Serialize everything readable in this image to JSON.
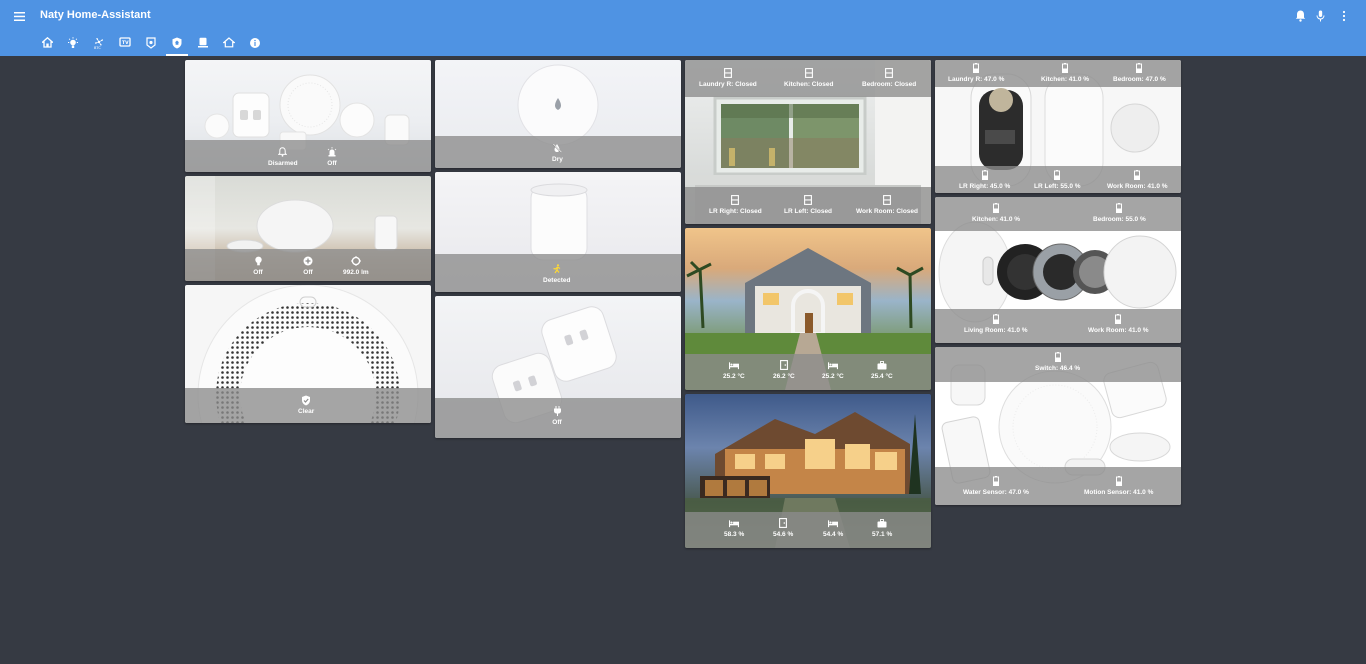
{
  "app": {
    "title": "Naty Home-Assistant"
  },
  "header": {
    "menu_icon": "menu-icon",
    "actions": [
      "bell-icon",
      "microphone-icon",
      "more-vert-icon"
    ]
  },
  "tabs": [
    {
      "icon": "home-icon"
    },
    {
      "icon": "lightbulb-on-icon"
    },
    {
      "icon": "fan-icon"
    },
    {
      "icon": "television-icon"
    },
    {
      "icon": "alarm-panel-icon"
    },
    {
      "icon": "shield-home-icon",
      "active": true
    },
    {
      "icon": "thermostat-icon"
    },
    {
      "icon": "house-roof-icon"
    },
    {
      "icon": "information-icon"
    }
  ],
  "cards": {
    "gateway": {
      "alarm": {
        "icon": "bell-outline-icon",
        "value": "Disarmed"
      },
      "siren": {
        "icon": "alarm-light-icon",
        "value": "Off"
      }
    },
    "gateway_light": {
      "light": {
        "icon": "lightbulb-icon",
        "value": "Off"
      },
      "switch": {
        "icon": "plus-circle-icon",
        "value": "Off"
      },
      "illuminance": {
        "icon": "brightness-icon",
        "value": "992.0 lm"
      }
    },
    "smoke": {
      "state": {
        "icon": "shield-check-icon",
        "value": "Clear"
      }
    },
    "water": {
      "state": {
        "icon": "water-off-icon",
        "value": "Dry"
      }
    },
    "motion": {
      "state": {
        "icon": "run-icon",
        "value": "Detected",
        "color": "#fdd835"
      }
    },
    "plug": {
      "state": {
        "icon": "power-plug-icon",
        "value": "Off"
      }
    },
    "windows": {
      "top": [
        {
          "icon": "window-closed-icon",
          "value": "Laundry R: Closed"
        },
        {
          "icon": "window-closed-icon",
          "value": "Kitchen: Closed"
        },
        {
          "icon": "window-closed-icon",
          "value": "Bedroom: Closed"
        }
      ],
      "bottom": [
        {
          "icon": "window-closed-icon",
          "value": "LR Right: Closed"
        },
        {
          "icon": "window-closed-icon",
          "value": "LR Left: Closed"
        },
        {
          "icon": "window-closed-icon",
          "value": "Work Room: Closed"
        }
      ]
    },
    "temperatures": [
      {
        "icon": "bed-icon",
        "value": "25.2 °C"
      },
      {
        "icon": "door-icon",
        "value": "26.2 °C"
      },
      {
        "icon": "bed-icon",
        "value": "25.2 °C"
      },
      {
        "icon": "briefcase-icon",
        "value": "25.4 °C"
      }
    ],
    "humidity": [
      {
        "icon": "bed-icon",
        "value": "58.3 %"
      },
      {
        "icon": "door-icon",
        "value": "54.6 %"
      },
      {
        "icon": "bed-icon",
        "value": "54.4 %"
      },
      {
        "icon": "briefcase-icon",
        "value": "57.1 %"
      }
    ],
    "battery_windows": {
      "top": [
        {
          "icon": "battery-icon",
          "value": "Laundry R: 47.0 %"
        },
        {
          "icon": "battery-icon",
          "value": "Kitchen: 41.0 %"
        },
        {
          "icon": "battery-icon",
          "value": "Bedroom: 47.0 %"
        }
      ],
      "bottom": [
        {
          "icon": "battery-icon",
          "value": "LR Right: 45.0 %"
        },
        {
          "icon": "battery-icon",
          "value": "LR Left: 55.0 %"
        },
        {
          "icon": "battery-icon",
          "value": "Work Room: 41.0 %"
        }
      ]
    },
    "battery_temps": {
      "top": [
        {
          "icon": "battery-icon",
          "value": "Kitchen: 41.0 %"
        },
        {
          "icon": "battery-icon",
          "value": "Bedroom: 55.0 %"
        }
      ],
      "bottom": [
        {
          "icon": "battery-icon",
          "value": "Living Room: 41.0 %"
        },
        {
          "icon": "battery-icon",
          "value": "Work Room: 41.0 %"
        }
      ]
    },
    "battery_devices": {
      "top": [
        {
          "icon": "battery-icon",
          "value": "Switch: 46.4 %"
        }
      ],
      "bottom": [
        {
          "icon": "battery-icon",
          "value": "Water Sensor: 47.0 %"
        },
        {
          "icon": "battery-icon",
          "value": "Motion Sensor: 41.0 %"
        }
      ]
    }
  }
}
